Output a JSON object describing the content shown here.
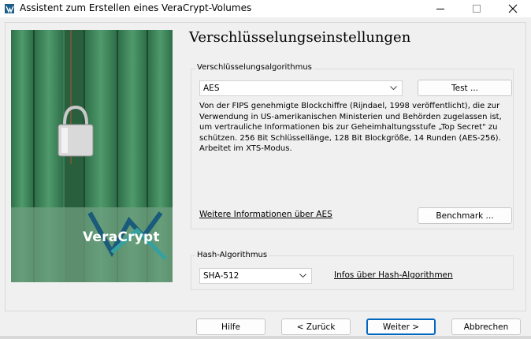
{
  "window": {
    "title": "Assistent zum Erstellen eines VeraCrypt-Volumes"
  },
  "side_image": {
    "logo_text": "VeraCrypt"
  },
  "page": {
    "title": "Verschlüsselungseinstellungen"
  },
  "encryption": {
    "group_label": "Verschlüsselungsalgorithmus",
    "selected": "AES",
    "test_button": "Test ...",
    "description": "Von der FIPS genehmigte Blockchiffre (Rijndael, 1998 veröffentlicht), die zur Verwendung in US-amerikanischen Ministerien und Behörden zugelassen ist, um vertrauliche Informationen bis zur Geheimhaltungsstufe „Top Secret\" zu schützen. 256 Bit Schlüssellänge, 128 Bit Blockgröße, 14 Runden (AES-256). Arbeitet im XTS-Modus.",
    "more_info_link": "Weitere Informationen über AES",
    "benchmark_button": "Benchmark ..."
  },
  "hash": {
    "group_label": "Hash-Algorithmus",
    "selected": "SHA-512",
    "info_link": "Infos über Hash-Algorithmen"
  },
  "footer": {
    "help": "Hilfe",
    "back": "< Zurück",
    "next": "Weiter >",
    "cancel": "Abbrechen"
  }
}
